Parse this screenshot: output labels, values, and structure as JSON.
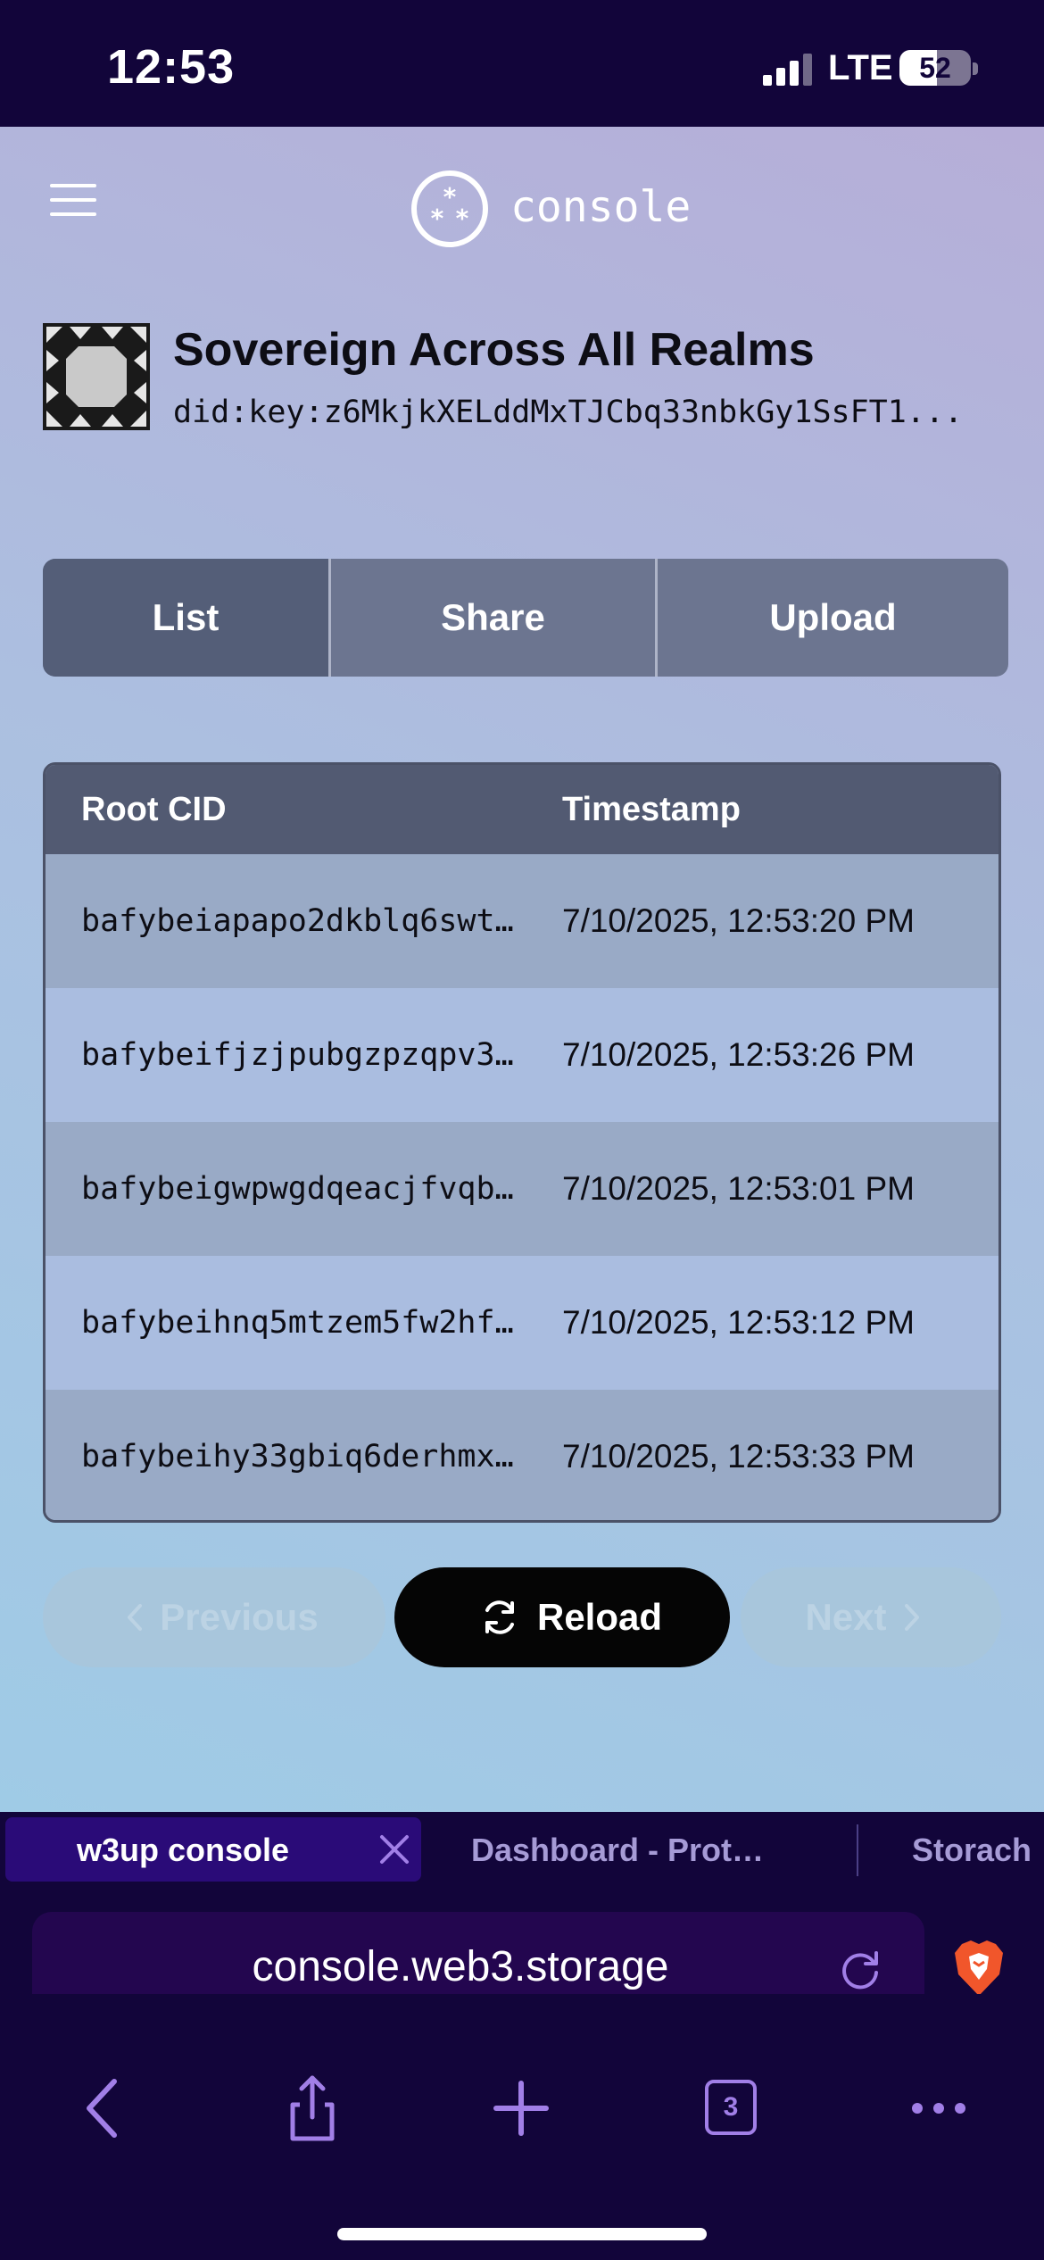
{
  "status_bar": {
    "time": "12:53",
    "network": "LTE",
    "battery": "52",
    "battery_level": 0.52
  },
  "header": {
    "logo_text": "console",
    "menu_icon": "hamburger-icon"
  },
  "space": {
    "name": "Sovereign Across All Realms",
    "did": "did:key:z6MkjkXELddMxTJCbq33nbkGy1SsFT1..."
  },
  "tabs": [
    {
      "label": "List"
    },
    {
      "label": "Share"
    },
    {
      "label": "Upload"
    }
  ],
  "table": {
    "headers": {
      "cid": "Root CID",
      "timestamp": "Timestamp"
    },
    "rows": [
      {
        "cid": "bafybeiapapo2dkblq6swt…",
        "timestamp": "7/10/2025, 12:53:20 PM"
      },
      {
        "cid": "bafybeifjzjpubgzpzqpv3…",
        "timestamp": "7/10/2025, 12:53:26 PM"
      },
      {
        "cid": "bafybeigwpwgdqeacjfvqb…",
        "timestamp": "7/10/2025, 12:53:01 PM"
      },
      {
        "cid": "bafybeihnq5mtzem5fw2hf…",
        "timestamp": "7/10/2025, 12:53:12 PM"
      },
      {
        "cid": "bafybeihy33gbiq6derhmx…",
        "timestamp": "7/10/2025, 12:53:33 PM"
      }
    ]
  },
  "pagination": {
    "previous": "Previous",
    "reload": "Reload",
    "next": "Next"
  },
  "browser": {
    "tabs": [
      {
        "title": "w3up console"
      },
      {
        "title": "Dashboard - Prot…"
      },
      {
        "title": "Storach"
      }
    ],
    "url": "console.web3.storage",
    "tab_count": "3"
  },
  "colors": {
    "accent_purple": "#a17fe7",
    "chrome_bg": "#12053a",
    "urlbar_bg": "#23064f"
  }
}
